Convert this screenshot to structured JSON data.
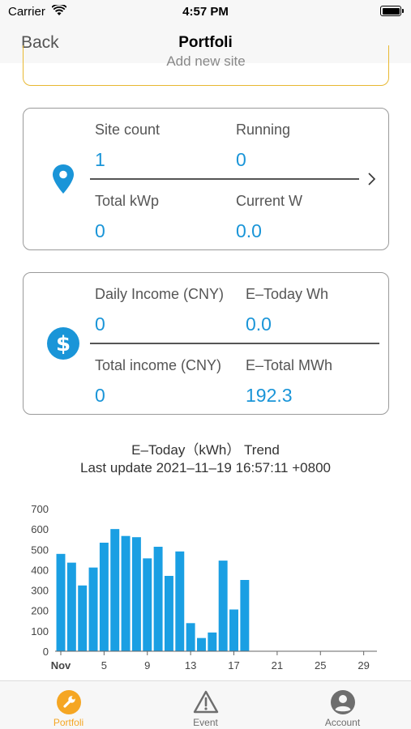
{
  "status_bar": {
    "carrier": "Carrier",
    "time": "4:57 PM"
  },
  "nav": {
    "back_label": "Back",
    "title": "Portfoli"
  },
  "add_site": {
    "label": "Add new site",
    "border_color": "#e8b832"
  },
  "site_card": {
    "site_count_label": "Site count",
    "site_count_value": "1",
    "running_label": "Running",
    "running_value": "0",
    "total_kwp_label": "Total kWp",
    "total_kwp_value": "0",
    "current_w_label": "Current W",
    "current_w_value": "0.0"
  },
  "income_card": {
    "daily_income_label": "Daily Income (CNY)",
    "daily_income_value": "0",
    "etoday_label": "E–Today Wh",
    "etoday_value": "0.0",
    "total_income_label": "Total income (CNY)",
    "total_income_value": "0",
    "etotal_label": "E–Total MWh",
    "etotal_value": "192.3"
  },
  "trend": {
    "title": "E–Today（kWh） Trend",
    "last_update": "Last update 2021–11–19 16:57:11 +0800"
  },
  "chart_data": {
    "type": "bar",
    "x": [
      1,
      2,
      3,
      4,
      5,
      6,
      7,
      8,
      9,
      10,
      11,
      12,
      13,
      14,
      15,
      16,
      17,
      18
    ],
    "values": [
      478,
      435,
      323,
      411,
      533,
      600,
      566,
      560,
      456,
      513,
      370,
      490,
      138,
      65,
      92,
      445,
      205,
      350
    ],
    "xlim": [
      1,
      30
    ],
    "ylim": [
      0,
      700
    ],
    "y_ticks": [
      0,
      100,
      200,
      300,
      400,
      500,
      600,
      700
    ],
    "x_ticks": [
      {
        "x": 1,
        "label": "Nov"
      },
      {
        "x": 5,
        "label": "5"
      },
      {
        "x": 9,
        "label": "9"
      },
      {
        "x": 13,
        "label": "13"
      },
      {
        "x": 17,
        "label": "17"
      },
      {
        "x": 21,
        "label": "21"
      },
      {
        "x": 25,
        "label": "25"
      },
      {
        "x": 29,
        "label": "29"
      }
    ],
    "bar_color": "#1a9fe3",
    "grid": false
  },
  "tabs": [
    {
      "label": "Portfoli",
      "icon": "wrench-icon",
      "active": true
    },
    {
      "label": "Event",
      "icon": "warning-icon",
      "active": false
    },
    {
      "label": "Account",
      "icon": "account-icon",
      "active": false
    }
  ],
  "colors": {
    "accent_blue": "#1a95d8",
    "tab_active": "#f5a623",
    "tab_inactive": "#6e6e6e"
  }
}
